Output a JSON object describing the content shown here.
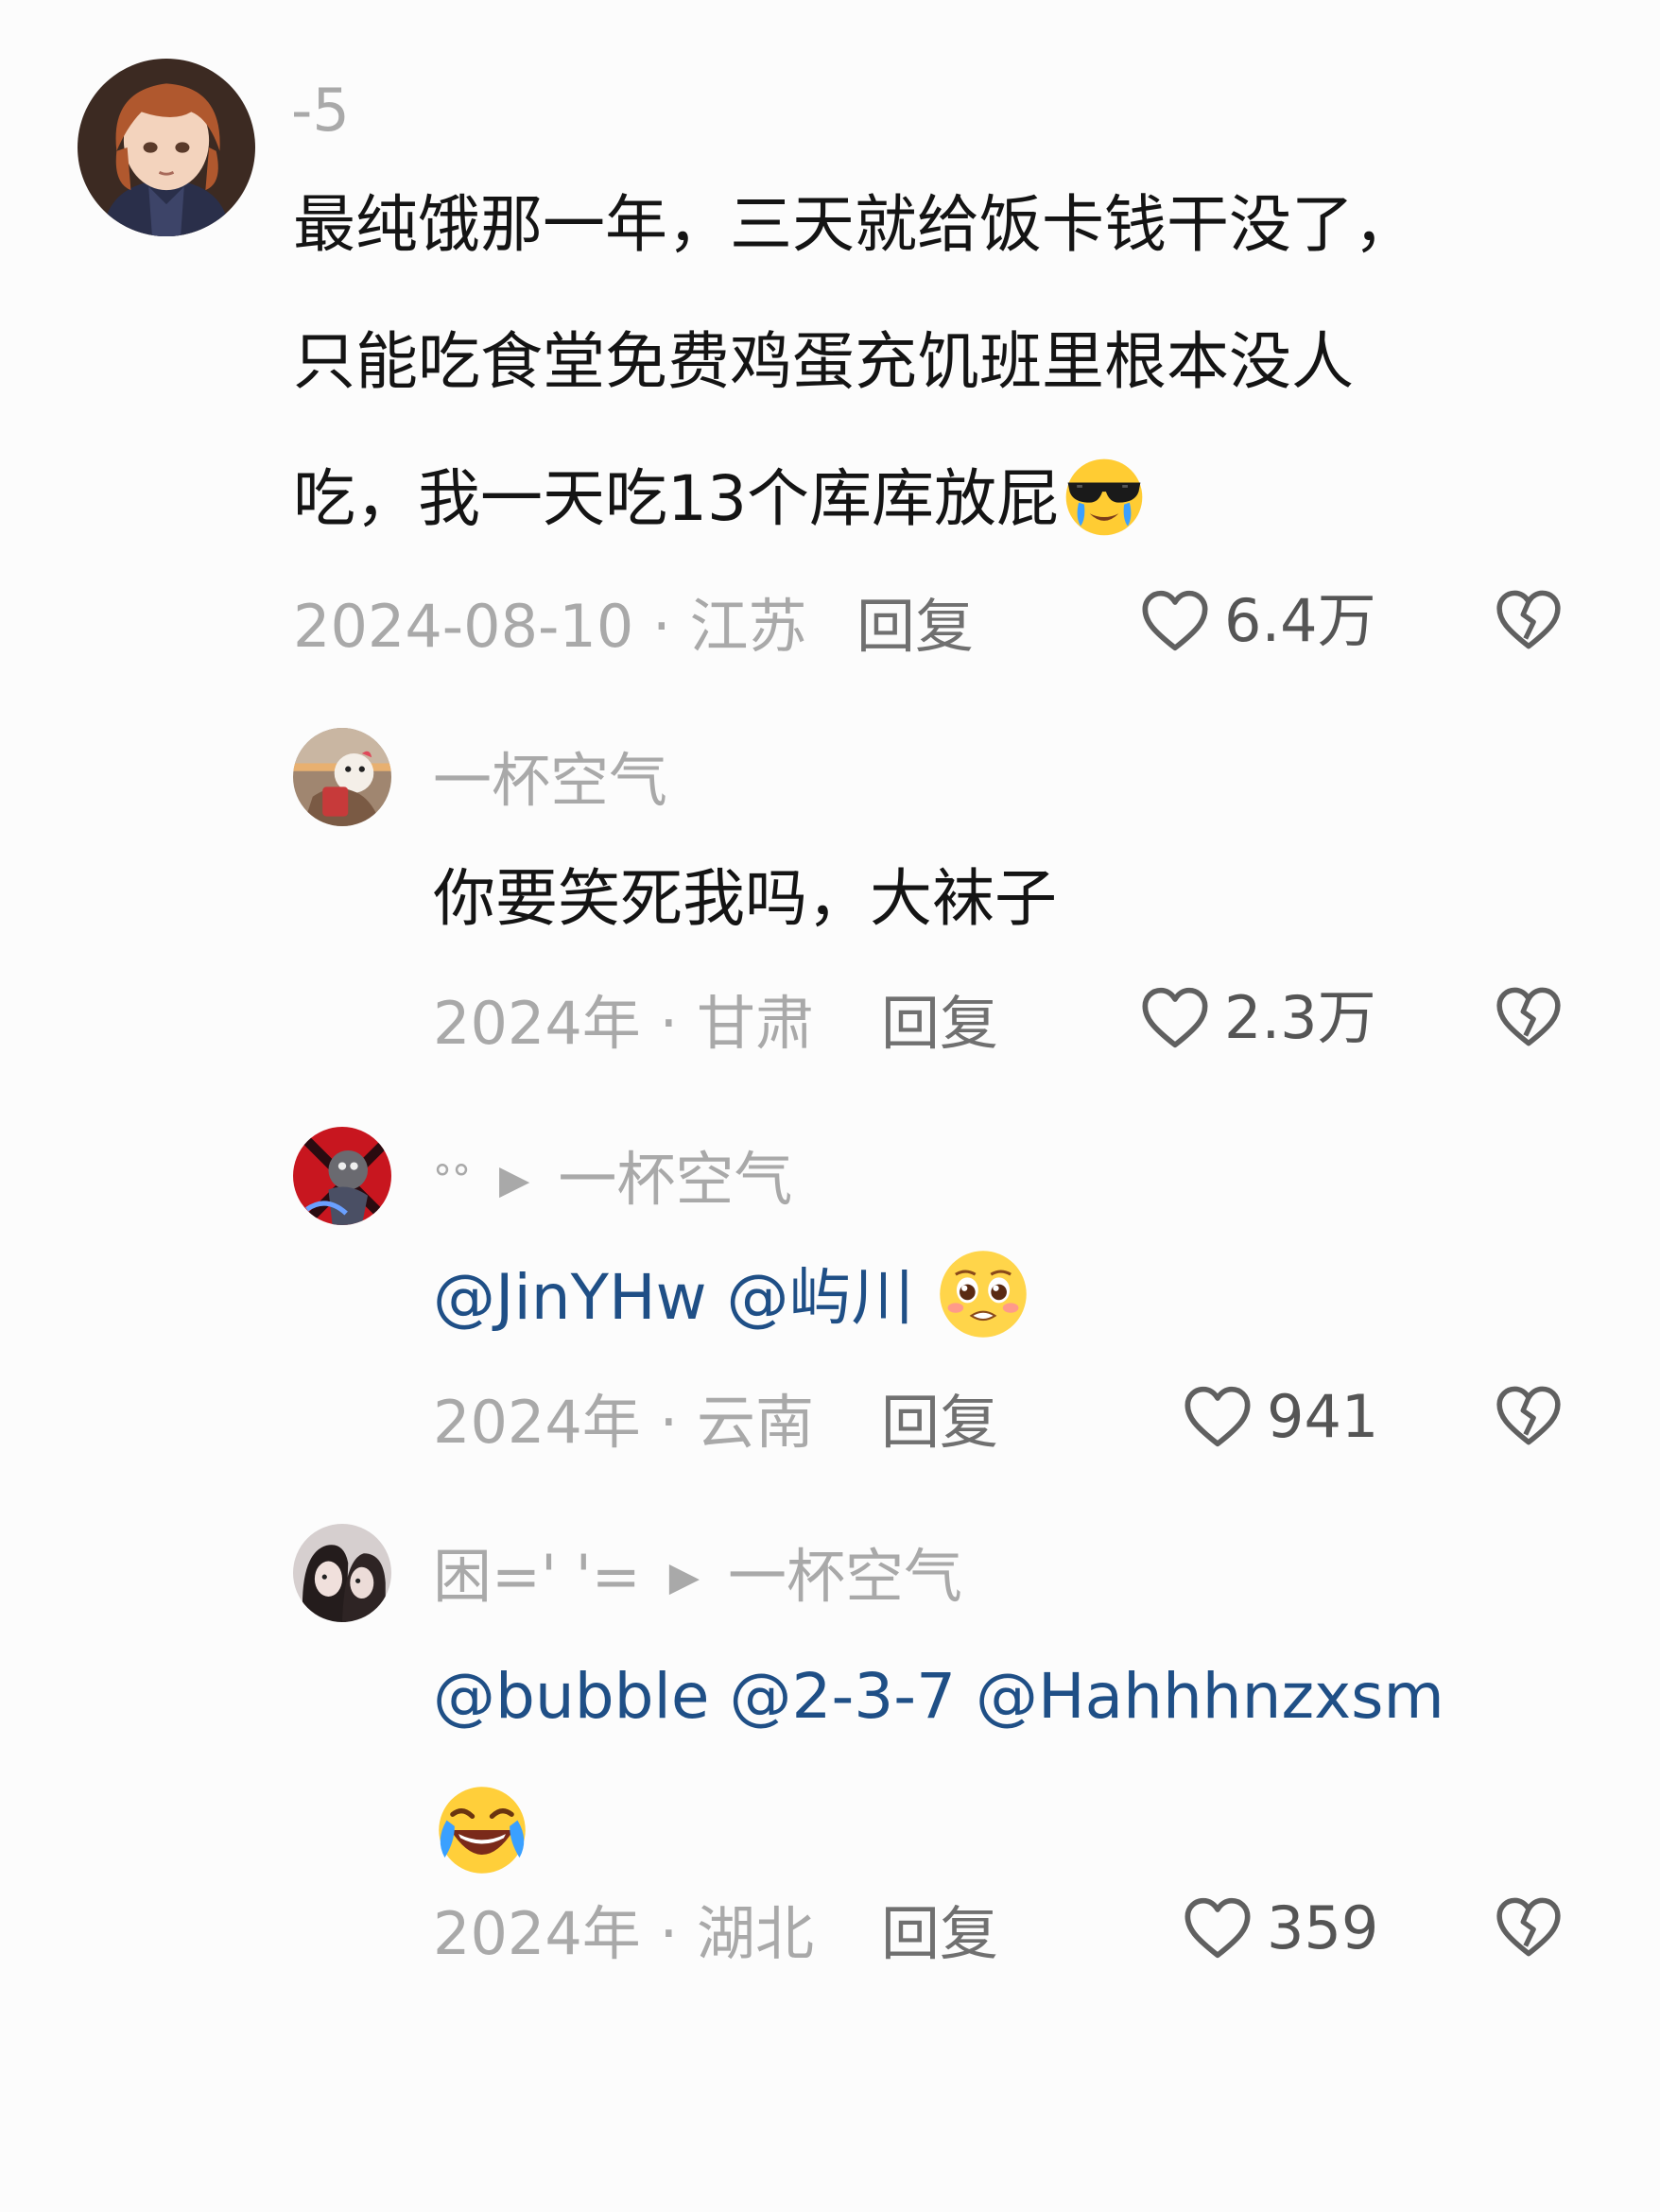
{
  "comments": [
    {
      "username": "-5",
      "text_lines": [
        "最纯饿那一年，三天就给饭卡钱干没了，",
        "只能吃食堂免费鸡蛋充饥班里根本没人",
        "吃，我一天吃13个库库放屁"
      ],
      "emoji": "sunglasses-crying-emoji",
      "date": "2024-08-10",
      "location": "江苏",
      "reply_label": "回复",
      "likes": "6.4万"
    },
    {
      "username": "一杯空气",
      "text": "你要笑死我吗，大袜子",
      "date": "2024年",
      "location": "甘肃",
      "reply_label": "回复",
      "likes": "2.3万"
    },
    {
      "username": "°°",
      "reply_to": "一杯空气",
      "mentions": [
        "@JinYHw",
        "@屿川"
      ],
      "emoji": "pleading-emoji",
      "date": "2024年",
      "location": "云南",
      "reply_label": "回复",
      "likes": "941"
    },
    {
      "username": "困=' '=",
      "reply_to": "一杯空气",
      "mentions": [
        "@bubble",
        "@2-3-7",
        "@Hahhhnzxsm"
      ],
      "emoji": "rolling-laughing-emoji",
      "date": "2024年",
      "location": "湖北",
      "reply_label": "回复",
      "likes": "359"
    }
  ],
  "separator": "·",
  "colors": {
    "text": "#141414",
    "muted": "#a9a9a9",
    "mention": "#1f4f86",
    "background": "#fcfcfc"
  },
  "icons": {
    "like": "heart-outline-icon",
    "dislike": "broken-heart-icon",
    "reply_arrow": "triangle-right-icon"
  }
}
